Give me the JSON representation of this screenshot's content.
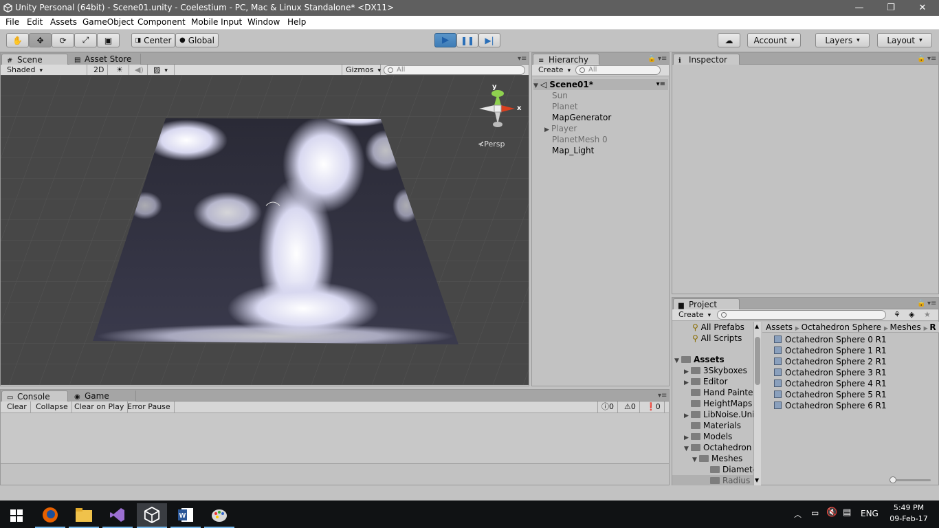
{
  "window": {
    "title": "Unity Personal (64bit) - Scene01.unity - Coelestium - PC, Mac & Linux Standalone* <DX11>",
    "minimize": "—",
    "restore": "❐",
    "close": "✕"
  },
  "menu": [
    "File",
    "Edit",
    "Assets",
    "GameObject",
    "Component",
    "Mobile Input",
    "Window",
    "Help"
  ],
  "toolbar": {
    "pivot": "Center",
    "space": "Global",
    "account": "Account",
    "layers": "Layers",
    "layout": "Layout"
  },
  "scene_tabs": {
    "scene": "Scene",
    "asset_store": "Asset Store"
  },
  "scene_bar": {
    "shading": "Shaded",
    "mode2d": "2D",
    "gizmos": "Gizmos",
    "search_placeholder": "All"
  },
  "gizmo": {
    "y": "y",
    "x": "x",
    "persp": "Persp"
  },
  "hierarchy": {
    "tab": "Hierarchy",
    "create": "Create",
    "search_placeholder": "All",
    "scene": "Scene01*",
    "items": [
      "Sun",
      "Planet",
      "MapGenerator",
      "Player",
      "PlanetMesh 0",
      "Map_Light"
    ]
  },
  "inspector": {
    "tab": "Inspector"
  },
  "console": {
    "tab": "Console",
    "game_tab": "Game",
    "clear": "Clear",
    "collapse": "Collapse",
    "clear_on_play": "Clear on Play",
    "error_pause": "Error Pause",
    "info_count": "0",
    "warn_count": "0",
    "error_count": "0"
  },
  "project": {
    "tab": "Project",
    "create": "Create",
    "favorites": [
      "All Prefabs",
      "All Scripts"
    ],
    "assets_root": "Assets",
    "tree": [
      "3Skyboxes",
      "Editor",
      "Hand Painted",
      "HeightMaps",
      "LibNoise.Unity",
      "Materials",
      "Models",
      "Octahedron",
      "Meshes",
      "Diameter",
      "Radius"
    ],
    "breadcrumb": [
      "Assets",
      "Octahedron Sphere",
      "Meshes",
      "R"
    ],
    "files": [
      "Octahedron Sphere 0 R1",
      "Octahedron Sphere 1 R1",
      "Octahedron Sphere 2 R1",
      "Octahedron Sphere 3 R1",
      "Octahedron Sphere 4 R1",
      "Octahedron Sphere 5 R1",
      "Octahedron Sphere 6 R1"
    ]
  },
  "taskbar": {
    "lang": "ENG",
    "time": "5:49 PM",
    "date": "09-Feb-17"
  }
}
